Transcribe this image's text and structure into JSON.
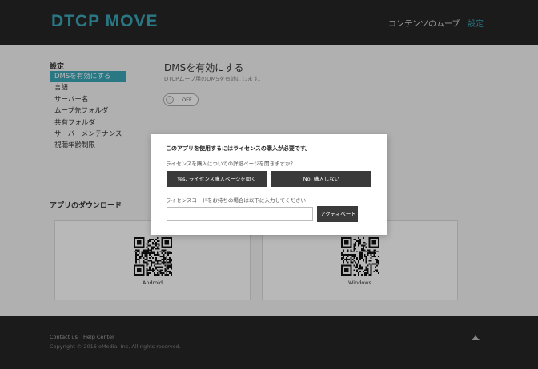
{
  "header": {
    "logo": "DTCP MOVE",
    "nav": [
      {
        "label": "コンテンツのムーブ"
      },
      {
        "label": "設定"
      }
    ],
    "accent_color": "#39a7b8"
  },
  "sidebar": {
    "title": "設定",
    "items": [
      {
        "label": "DMSを有効にする",
        "active": true
      },
      {
        "label": "言語"
      },
      {
        "label": "サーバー名"
      },
      {
        "label": "ムーブ先フォルダ"
      },
      {
        "label": "共有フォルダ"
      },
      {
        "label": "サーバーメンテナンス"
      },
      {
        "label": "視聴年齢制限"
      }
    ]
  },
  "content": {
    "title": "DMSを有効にする",
    "subtitle": "DTCPムーブ用のDMSを有効にします。",
    "toggle_label": "OFF"
  },
  "downloads": {
    "title": "アプリのダウンロード",
    "items": [
      {
        "label": "Android",
        "icon": "qr-code-icon"
      },
      {
        "label": "Windows",
        "icon": "qr-code-icon"
      }
    ]
  },
  "footer": {
    "links": [
      "Contact us",
      "Help Center"
    ],
    "copyright": "Copyright © 2016 eMedia, Inc. All rights reserved."
  },
  "modal": {
    "title": "このアプリを使用するにはライセンスの購入が必要です。",
    "question": "ライセンスを購入についての詳細ページを開きますか？",
    "yes_label": "Yes, ライセンス購入ページを開く",
    "no_label": "No, 購入しない",
    "code_label": "ライセンスコードをお持ちの場合は以下に入力してください",
    "code_value": "",
    "activate_label": "アクティベート"
  }
}
